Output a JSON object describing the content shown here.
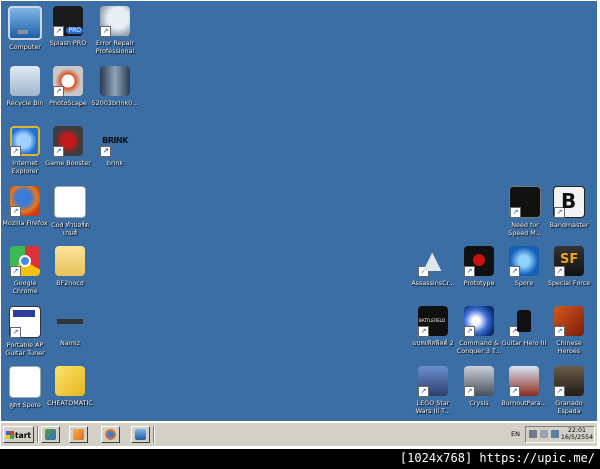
{
  "desktop": {
    "background_color": "#3a6ea5",
    "icons": [
      {
        "label": "Computer",
        "icon": "computer-icon",
        "shortcut": false
      },
      {
        "label": "Splash PRO",
        "icon": "splash-pro-icon",
        "shortcut": true
      },
      {
        "label": "Error Repair Professional",
        "icon": "error-repair-icon",
        "shortcut": true
      },
      {
        "label": "Recycle Bin",
        "icon": "recycle-bin-icon",
        "shortcut": false
      },
      {
        "label": "PhotoScape",
        "icon": "photoscape-icon",
        "shortcut": true
      },
      {
        "label": "52003brink0...",
        "icon": "video-thumbnail-icon",
        "shortcut": false
      },
      {
        "label": "Internet Explorer",
        "icon": "internet-explorer-icon",
        "shortcut": true
      },
      {
        "label": "Game Booster",
        "icon": "game-booster-icon",
        "shortcut": true
      },
      {
        "label": "brink",
        "icon": "brink-icon",
        "shortcut": true,
        "art_text": "BRINK"
      },
      {
        "label": "Mozilla Firefox",
        "icon": "firefox-icon",
        "shortcut": true
      },
      {
        "label": "Cod ทำบอร์ด เกมส์",
        "icon": "document-icon",
        "shortcut": false
      },
      {
        "label": "Google Chrome",
        "icon": "chrome-icon",
        "shortcut": true
      },
      {
        "label": "BF2nocd",
        "icon": "folder-icon",
        "shortcut": false
      },
      {
        "label": "Portable AP Guitar Tuner",
        "icon": "guitar-tuner-icon",
        "shortcut": true
      },
      {
        "label": "Namiz",
        "icon": "namiz-icon",
        "shortcut": false
      },
      {
        "label": "ลูตร Spore",
        "icon": "text-document-icon",
        "shortcut": false
      },
      {
        "label": "CHEATOMATIC",
        "icon": "cheese-icon",
        "shortcut": false
      },
      {
        "label": "Need for Speed M...",
        "icon": "need-for-speed-icon",
        "shortcut": true
      },
      {
        "label": "Bandmaster",
        "icon": "bandmaster-icon",
        "shortcut": true
      },
      {
        "label": "AssassinsCr...",
        "icon": "assassins-creed-icon",
        "shortcut": true
      },
      {
        "label": "Prototype",
        "icon": "prototype-icon",
        "shortcut": true
      },
      {
        "label": "Spore",
        "icon": "spore-icon",
        "shortcut": true
      },
      {
        "label": "Special Force",
        "icon": "special-force-icon",
        "shortcut": true
      },
      {
        "label": "แบทเทิลฟิลด์ 2",
        "icon": "battlefield-2-icon",
        "shortcut": true
      },
      {
        "label": "Command & Conquer 3 T...",
        "icon": "command-conquer-icon",
        "shortcut": true
      },
      {
        "label": "Guitar Hero III",
        "icon": "guitar-hero-icon",
        "shortcut": true
      },
      {
        "label": "Chinese Heroes",
        "icon": "chinese-heroes-icon",
        "shortcut": true
      },
      {
        "label": "LEGO Star Wars III T...",
        "icon": "lego-star-wars-icon",
        "shortcut": true
      },
      {
        "label": "Crysis",
        "icon": "crysis-icon",
        "shortcut": true
      },
      {
        "label": "BurnoutPara...",
        "icon": "burnout-paradise-icon",
        "shortcut": true
      },
      {
        "label": "Granado Espada",
        "icon": "granado-espada-icon",
        "shortcut": true
      }
    ]
  },
  "taskbar": {
    "start_label": "Start",
    "quick_launch": [
      "show-desktop-icon",
      "media-player-icon",
      "firefox-icon",
      "computer-icon"
    ],
    "language": "EN",
    "clock_time": "22:01",
    "clock_date": "16/5/2554"
  },
  "watermark": "[1024x768] https://upic.me/"
}
